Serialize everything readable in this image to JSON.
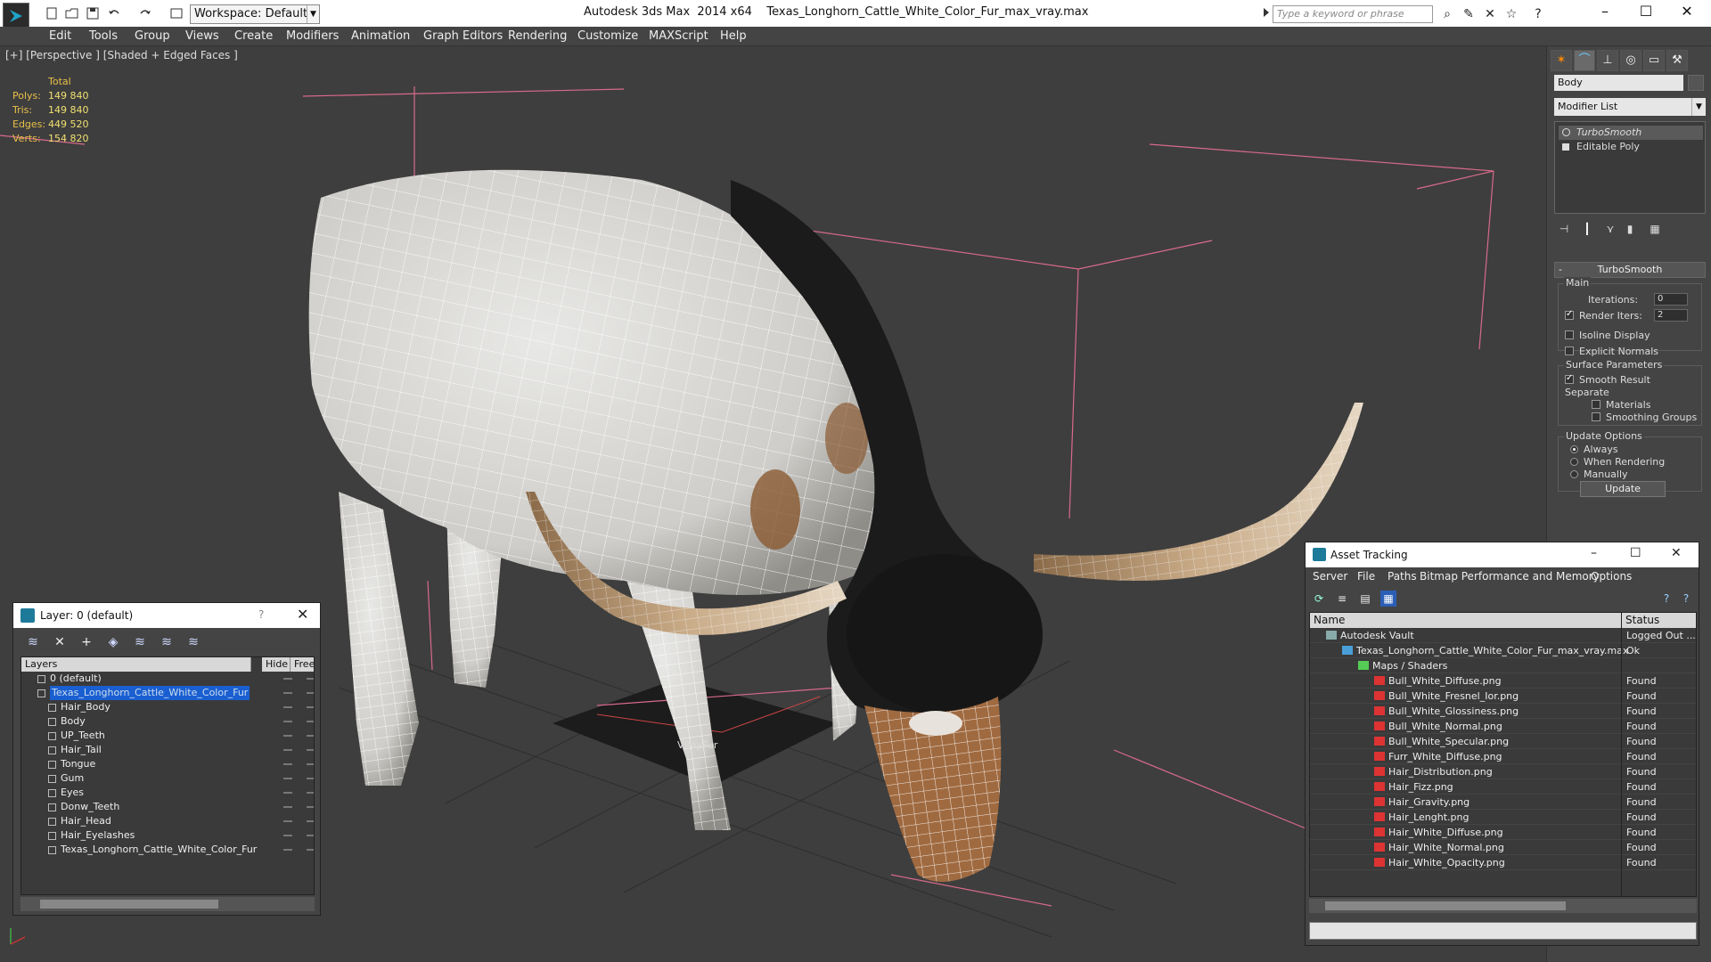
{
  "titlebar": {
    "workspace": "Workspace: Default",
    "app_title": "Autodesk 3ds Max  2014 x64",
    "file_name": "Texas_Longhorn_Cattle_White_Color_Fur_max_vray.max",
    "search_placeholder": "Type a keyword or phrase"
  },
  "menu": [
    "Edit",
    "Tools",
    "Group",
    "Views",
    "Create",
    "Modifiers",
    "Animation",
    "Graph Editors",
    "Rendering",
    "Customize",
    "MAXScript",
    "Help"
  ],
  "viewport": {
    "label": "[+] [Perspective ] [Shaded + Edged Faces ]",
    "stats": {
      "total_label": "Total",
      "rows": [
        {
          "label": "Polys:",
          "value": "149 840"
        },
        {
          "label": "Tris:",
          "value": "149 840"
        },
        {
          "label": "Edges:",
          "value": "449 520"
        },
        {
          "label": "Verts:",
          "value": "154 820"
        }
      ]
    },
    "helper_label": "VRayFur"
  },
  "command_panel": {
    "object_name": "Body",
    "modifier_list": "Modifier List",
    "stack": [
      "TurboSmooth",
      "Editable Poly"
    ],
    "rollout_title": "TurboSmooth",
    "main": {
      "group": "Main",
      "iterations_label": "Iterations:",
      "iterations_value": "0",
      "render_iters_label": "Render Iters:",
      "render_iters_value": "2",
      "isoline": "Isoline Display",
      "explicit": "Explicit Normals"
    },
    "surface": {
      "group": "Surface Parameters",
      "smooth_result": "Smooth Result",
      "separate": "Separate",
      "materials": "Materials",
      "smoothing_groups": "Smoothing Groups"
    },
    "update": {
      "group": "Update Options",
      "always": "Always",
      "when_rendering": "When Rendering",
      "manually": "Manually",
      "button": "Update"
    }
  },
  "layer_window": {
    "title": "Layer: 0 (default)",
    "help": "?",
    "headers": {
      "layers": "Layers",
      "hide": "Hide",
      "freeze": "Free"
    },
    "rows": [
      {
        "name": "0 (default)",
        "type": "layer",
        "level": 0
      },
      {
        "name": "Texas_Longhorn_Cattle_White_Color_Fur",
        "type": "layer",
        "level": 0,
        "selected": true
      },
      {
        "name": "Hair_Body",
        "type": "object",
        "level": 1
      },
      {
        "name": "Body",
        "type": "object",
        "level": 1
      },
      {
        "name": "UP_Teeth",
        "type": "object",
        "level": 1
      },
      {
        "name": "Hair_Tail",
        "type": "object",
        "level": 1
      },
      {
        "name": "Tongue",
        "type": "object",
        "level": 1
      },
      {
        "name": "Gum",
        "type": "object",
        "level": 1
      },
      {
        "name": "Eyes",
        "type": "object",
        "level": 1
      },
      {
        "name": "Donw_Teeth",
        "type": "object",
        "level": 1
      },
      {
        "name": "Hair_Head",
        "type": "object",
        "level": 1
      },
      {
        "name": "Hair_Eyelashes",
        "type": "object",
        "level": 1
      },
      {
        "name": "Texas_Longhorn_Cattle_White_Color_Fur",
        "type": "object",
        "level": 1
      }
    ]
  },
  "asset_window": {
    "title": "Asset Tracking",
    "menu": [
      "Server",
      "File",
      "Paths",
      "Bitmap Performance and Memory",
      "Options"
    ],
    "headers": {
      "name": "Name",
      "status": "Status"
    },
    "rows": [
      {
        "name": "Autodesk Vault",
        "status": "Logged Out ...",
        "level": 0,
        "icon": "vault"
      },
      {
        "name": "Texas_Longhorn_Cattle_White_Color_Fur_max_vray.max",
        "status": "Ok",
        "level": 1,
        "icon": "max"
      },
      {
        "name": "Maps / Shaders",
        "status": "",
        "level": 2,
        "icon": "maps"
      },
      {
        "name": "Bull_White_Diffuse.png",
        "status": "Found",
        "level": 3,
        "icon": "png"
      },
      {
        "name": "Bull_White_Fresnel_Ior.png",
        "status": "Found",
        "level": 3,
        "icon": "png"
      },
      {
        "name": "Bull_White_Glossiness.png",
        "status": "Found",
        "level": 3,
        "icon": "png"
      },
      {
        "name": "Bull_White_Normal.png",
        "status": "Found",
        "level": 3,
        "icon": "png"
      },
      {
        "name": "Bull_White_Specular.png",
        "status": "Found",
        "level": 3,
        "icon": "png"
      },
      {
        "name": "Furr_White_Diffuse.png",
        "status": "Found",
        "level": 3,
        "icon": "png"
      },
      {
        "name": "Hair_Distribution.png",
        "status": "Found",
        "level": 3,
        "icon": "png"
      },
      {
        "name": "Hair_Fizz.png",
        "status": "Found",
        "level": 3,
        "icon": "png"
      },
      {
        "name": "Hair_Gravity.png",
        "status": "Found",
        "level": 3,
        "icon": "png"
      },
      {
        "name": "Hair_Lenght.png",
        "status": "Found",
        "level": 3,
        "icon": "png"
      },
      {
        "name": "Hair_White_Diffuse.png",
        "status": "Found",
        "level": 3,
        "icon": "png"
      },
      {
        "name": "Hair_White_Normal.png",
        "status": "Found",
        "level": 3,
        "icon": "png"
      },
      {
        "name": "Hair_White_Opacity.png",
        "status": "Found",
        "level": 3,
        "icon": "png"
      }
    ]
  }
}
